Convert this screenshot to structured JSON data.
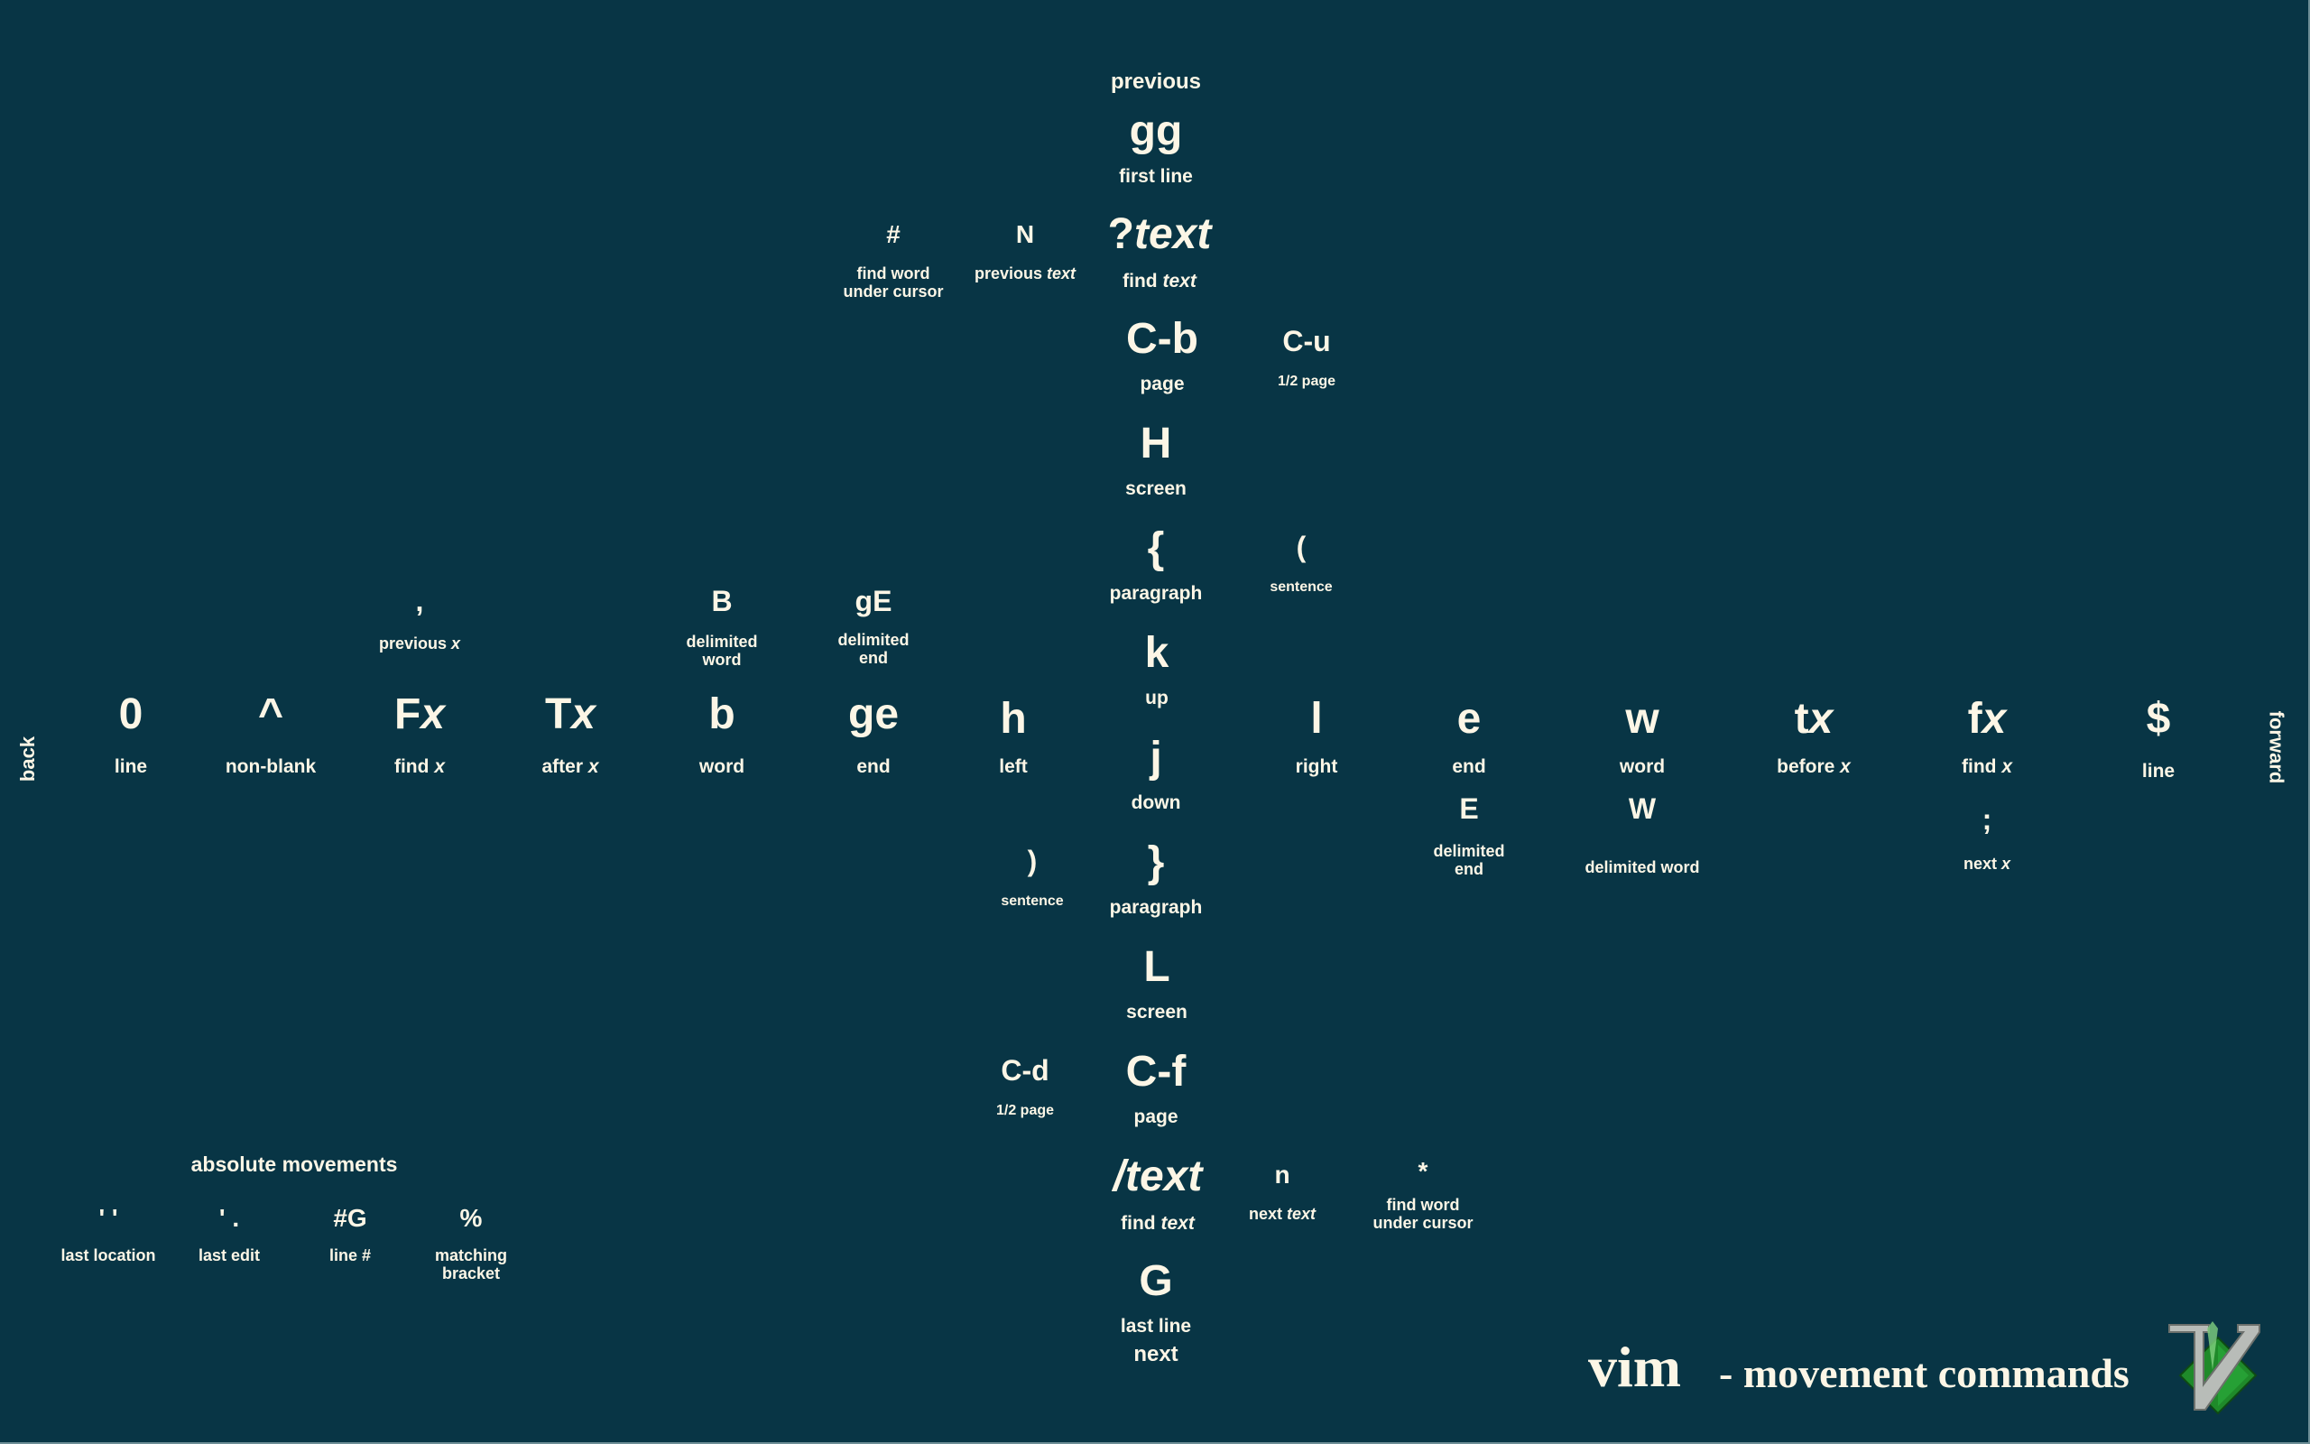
{
  "title": {
    "app": "vim",
    "subtitle": "- movement commands",
    "logo_icon": "vim-logo-icon"
  },
  "directions": {
    "up": "previous",
    "down": "next",
    "left": "back",
    "right": "forward"
  },
  "vertical": {
    "gg": {
      "key": "gg",
      "label": "first line"
    },
    "search_back": {
      "key_prefix": "?",
      "key_italic": "text",
      "label_prefix": "find ",
      "label_italic": "text"
    },
    "hash": {
      "key": "#",
      "label_line1": "find word",
      "label_line2": "under cursor"
    },
    "N": {
      "key": "N",
      "label_prefix": "previous ",
      "label_italic": "text"
    },
    "Cb": {
      "key": "C-b",
      "label": "page"
    },
    "Cu": {
      "key": "C-u",
      "label": "1/2 page"
    },
    "H": {
      "key": "H",
      "label": "screen"
    },
    "lbrace": {
      "key": "{",
      "label": "paragraph"
    },
    "lparen": {
      "key": "(",
      "label": "sentence"
    },
    "k": {
      "key": "k",
      "label": "up"
    },
    "j": {
      "key": "j",
      "label": "down"
    },
    "rbrace": {
      "key": "}",
      "label": "paragraph"
    },
    "rparen": {
      "key": ")",
      "label": "sentence"
    },
    "L": {
      "key": "L",
      "label": "screen"
    },
    "Cd": {
      "key": "C-d",
      "label": "1/2 page"
    },
    "Cf": {
      "key": "C-f",
      "label": "page"
    },
    "search_fwd": {
      "key_prefix": "/",
      "key_italic": "text",
      "label_prefix": "find ",
      "label_italic": "text"
    },
    "n": {
      "key": "n",
      "label_prefix": "next ",
      "label_italic": "text"
    },
    "star": {
      "key": "*",
      "label_line1": "find word",
      "label_line2": "under cursor"
    },
    "G": {
      "key": "G",
      "label": "last line"
    }
  },
  "horizontal": {
    "zero": {
      "key": "0",
      "label": "line"
    },
    "caret": {
      "key": "^",
      "label": "non-blank"
    },
    "Fx": {
      "key_prefix": "F",
      "key_italic": "x",
      "label_prefix": "find ",
      "label_italic": "x"
    },
    "comma": {
      "key": ",",
      "label_prefix": "previous ",
      "label_italic": "x"
    },
    "Tx": {
      "key_prefix": "T",
      "key_italic": "x",
      "label_prefix": "after ",
      "label_italic": "x"
    },
    "b": {
      "key": "b",
      "label": "word"
    },
    "B": {
      "key": "B",
      "label_line1": "delimited",
      "label_line2": "word"
    },
    "ge": {
      "key": "ge",
      "label": "end"
    },
    "gE": {
      "key": "gE",
      "label_line1": "delimited",
      "label_line2": "end"
    },
    "h": {
      "key": "h",
      "label": "left"
    },
    "l": {
      "key": "l",
      "label": "right"
    },
    "e": {
      "key": "e",
      "label": "end"
    },
    "E": {
      "key": "E",
      "label_line1": "delimited",
      "label_line2": "end"
    },
    "w": {
      "key": "w",
      "label": "word"
    },
    "W": {
      "key": "W",
      "label": "delimited word"
    },
    "tx": {
      "key_prefix": "t",
      "key_italic": "x",
      "label_prefix": "before ",
      "label_italic": "x"
    },
    "fx": {
      "key_prefix": "f",
      "key_italic": "x",
      "label_prefix": "find ",
      "label_italic": "x"
    },
    "semicolon": {
      "key": ";",
      "label_prefix": "next ",
      "label_italic": "x"
    },
    "dollar": {
      "key": "$",
      "label": "line"
    }
  },
  "absolute": {
    "heading": "absolute movements",
    "items": [
      {
        "key": "' '",
        "label_line1": "last location"
      },
      {
        "key": "' .",
        "label_line1": "last edit"
      },
      {
        "key": "#G",
        "label_line1": "line #"
      },
      {
        "key": "%",
        "label_line1": "matching",
        "label_line2": "bracket"
      }
    ]
  }
}
